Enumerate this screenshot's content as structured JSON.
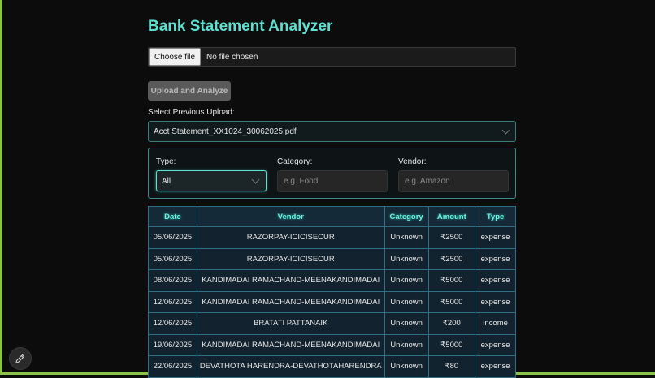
{
  "page": {
    "title": "Bank Statement Analyzer"
  },
  "upload": {
    "choose_label": "Choose file",
    "file_status": "No file chosen",
    "button_label": "Upload and Analyze"
  },
  "previous": {
    "label": "Select Previous Upload:",
    "selected": "Acct Statement_XX1024_30062025.pdf"
  },
  "filters": {
    "type_label": "Type:",
    "type_value": "All",
    "category_label": "Category:",
    "category_placeholder": "e.g. Food",
    "vendor_label": "Vendor:",
    "vendor_placeholder": "e.g. Amazon"
  },
  "table": {
    "headers": [
      "Date",
      "Vendor",
      "Category",
      "Amount",
      "Type"
    ],
    "rows": [
      [
        "05/06/2025",
        "RAZORPAY-ICICISECUR",
        "Unknown",
        "₹2500",
        "expense"
      ],
      [
        "05/06/2025",
        "RAZORPAY-ICICISECUR",
        "Unknown",
        "₹2500",
        "expense"
      ],
      [
        "08/06/2025",
        "KANDIMADAI RAMACHAND-MEENAKANDIMADAI",
        "Unknown",
        "₹5000",
        "expense"
      ],
      [
        "12/06/2025",
        "KANDIMADAI RAMACHAND-MEENAKANDIMADAI",
        "Unknown",
        "₹5000",
        "expense"
      ],
      [
        "12/06/2025",
        "BRATATI PATTANAIK",
        "Unknown",
        "₹200",
        "income"
      ],
      [
        "19/06/2025",
        "KANDIMADAI RAMACHAND-MEENAKANDIMADAI",
        "Unknown",
        "₹5000",
        "expense"
      ],
      [
        "22/06/2025",
        "DEVATHOTA HARENDRA-DEVATHOTAHARENDRA",
        "Unknown",
        "₹80",
        "expense"
      ]
    ]
  },
  "icons": {
    "edit": "pencil-icon"
  },
  "colors": {
    "accent": "#5ee0d0",
    "frame": "#8bc34a"
  }
}
